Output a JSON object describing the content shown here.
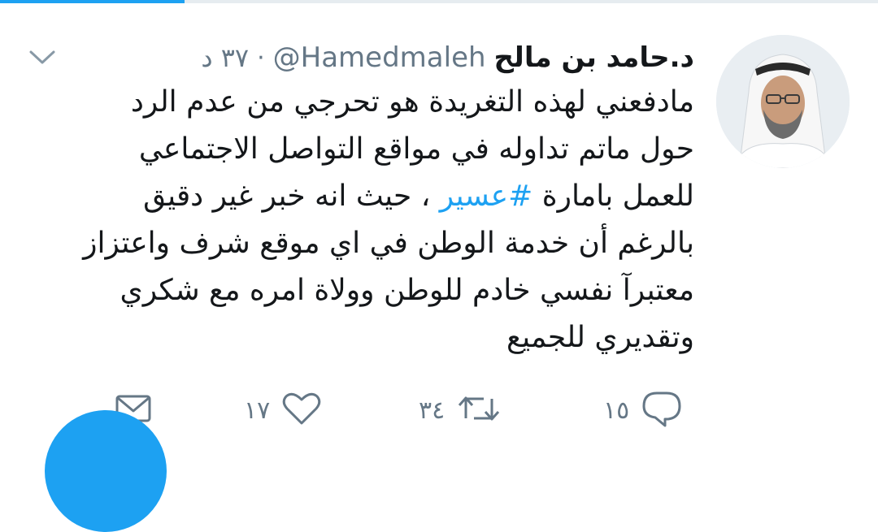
{
  "colors": {
    "accent": "#1da1f2",
    "text_primary": "#14171a",
    "text_secondary": "#657786"
  },
  "loading": {
    "progress": 0.21
  },
  "tweet": {
    "author_name": "د.حامد بن مالح",
    "handle": "@Hamedmaleh",
    "separator": "·",
    "time": "٣٧ د",
    "avatar_icon": "user-photo",
    "more_icon": "chevron-down-icon",
    "text_lines": [
      {
        "text": "مادفعني لهذه التغريدة هو تحرجي من عدم الرد"
      },
      {
        "text": "حول  ماتم تداوله في مواقع التواصل الاجتماعي"
      },
      {
        "before": "للعمل بامارة ",
        "hashtag": "#عسير",
        "after": " ، حيث انه خبر غير دقيق"
      },
      {
        "text": "بالرغم أن خدمة الوطن في اي موقع شرف واعتزاز"
      },
      {
        "text": "معتبرآ نفسي خادم للوطن وولاة امره مع شكري"
      },
      {
        "text": "وتقديري للجميع"
      }
    ]
  },
  "actions": {
    "reply_count": "١٥",
    "retweet_count": "٣٤",
    "like_count": "١٧",
    "icons": [
      "reply-icon",
      "retweet-icon",
      "like-icon",
      "direct-message-icon"
    ]
  },
  "compose_fab": {
    "icon": "compose-fab"
  }
}
